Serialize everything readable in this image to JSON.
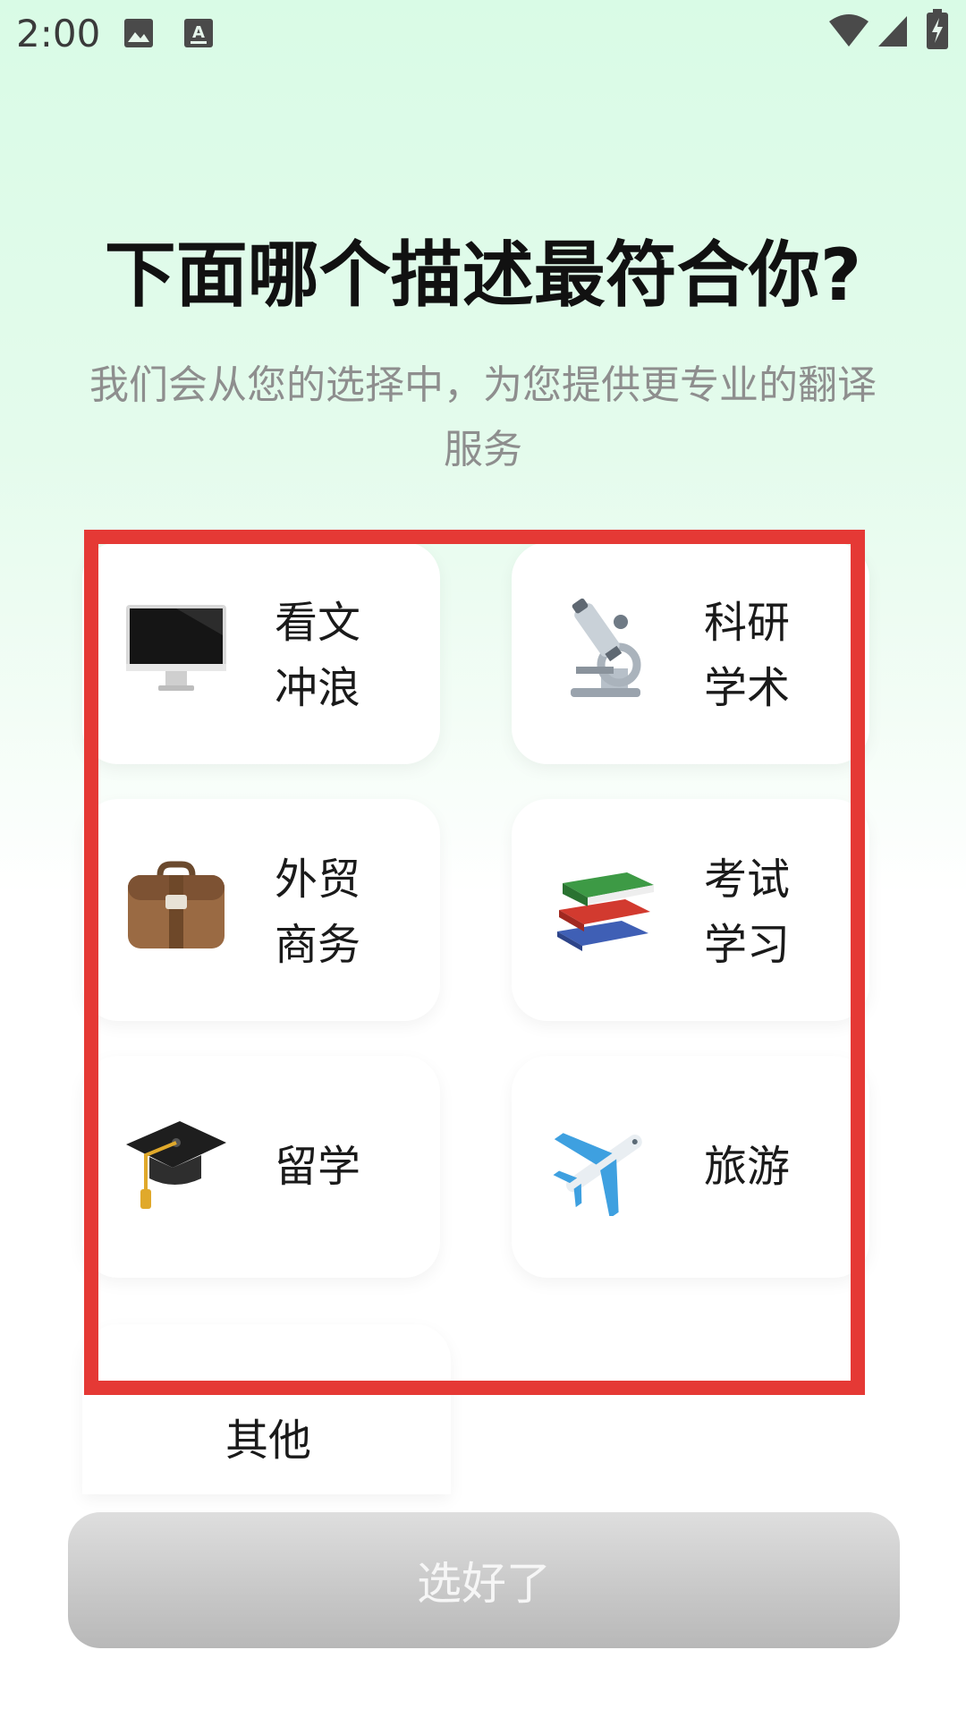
{
  "status_bar": {
    "time": "2:00",
    "icons": [
      "image-icon",
      "a-keyboard-icon",
      "wifi-icon",
      "signal-icon",
      "battery-charging-icon"
    ]
  },
  "header": {
    "title": "下面哪个描述最符合你?",
    "subtitle": "我们会从您的选择中，为您提供更专业的翻译服务"
  },
  "options": [
    {
      "label_line1": "看文",
      "label_line2": "冲浪",
      "icon": "monitor-icon"
    },
    {
      "label_line1": "科研",
      "label_line2": "学术",
      "icon": "microscope-icon"
    },
    {
      "label_line1": "外贸",
      "label_line2": "商务",
      "icon": "briefcase-icon"
    },
    {
      "label_line1": "考试",
      "label_line2": "学习",
      "icon": "books-icon"
    },
    {
      "label": "留学",
      "icon": "graduation-cap-icon"
    },
    {
      "label": "旅游",
      "icon": "airplane-icon"
    },
    {
      "label": "其他"
    }
  ],
  "confirm_button": {
    "label": "选好了",
    "enabled": false
  },
  "colors": {
    "highlight_border": "#e53935",
    "background_top": "#d9fbe6",
    "button_disabled": "#c8c8c8"
  }
}
